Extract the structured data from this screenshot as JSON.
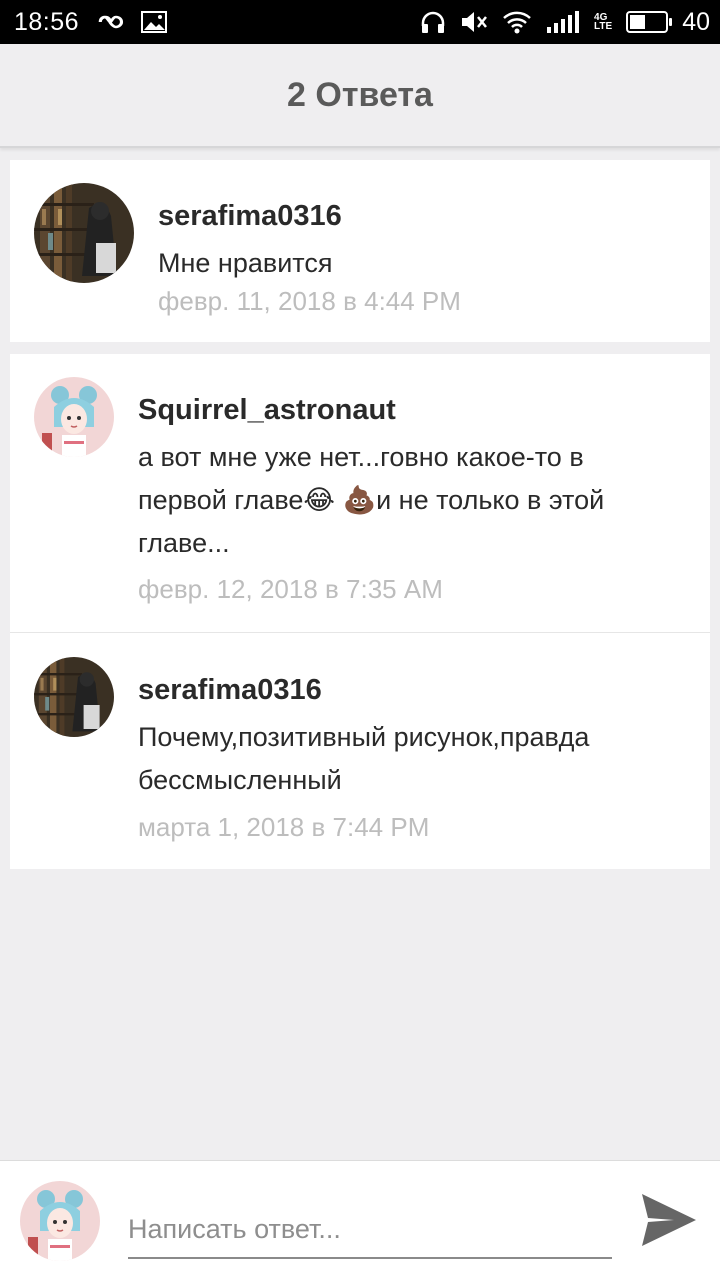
{
  "status_bar": {
    "time": "18:56",
    "network_type_top": "4G",
    "network_type_bottom": "LTE",
    "battery_level": "40",
    "icons": [
      "infinity-icon",
      "image-icon",
      "headphones-icon",
      "mute-icon",
      "wifi-icon",
      "signal-icon",
      "battery-icon"
    ]
  },
  "header": {
    "title": "2 Ответа"
  },
  "comments": [
    {
      "user": "serafima0316",
      "text_lines": [
        "Мне нравится"
      ],
      "date": "февр. 11, 2018 в 4:44 PM",
      "avatar": "library-avatar"
    },
    {
      "user": "Squirrel_astronaut",
      "text_lines": [
        "а вот мне уже нет...говно какое-то в",
        "первой главе",
        "и не только в этой",
        "главе..."
      ],
      "emoji": [
        "😂",
        "💩"
      ],
      "date": "февр. 12, 2018 в 7:35 AM",
      "avatar": "anime-girl-avatar"
    },
    {
      "user": "serafima0316",
      "text_lines": [
        "Почему,позитивный рисунок,правда",
        "бессмысленный"
      ],
      "date": "марта 1, 2018 в 7:44 PM",
      "avatar": "library-avatar"
    }
  ],
  "compose": {
    "placeholder": "Написать ответ...",
    "value": "",
    "send_icon": "send-icon"
  },
  "colors": {
    "background": "#efeef0",
    "card": "#ffffff",
    "username": "#2a2a2a",
    "date": "#bdbdbd",
    "header_title": "#5a5a5a"
  }
}
